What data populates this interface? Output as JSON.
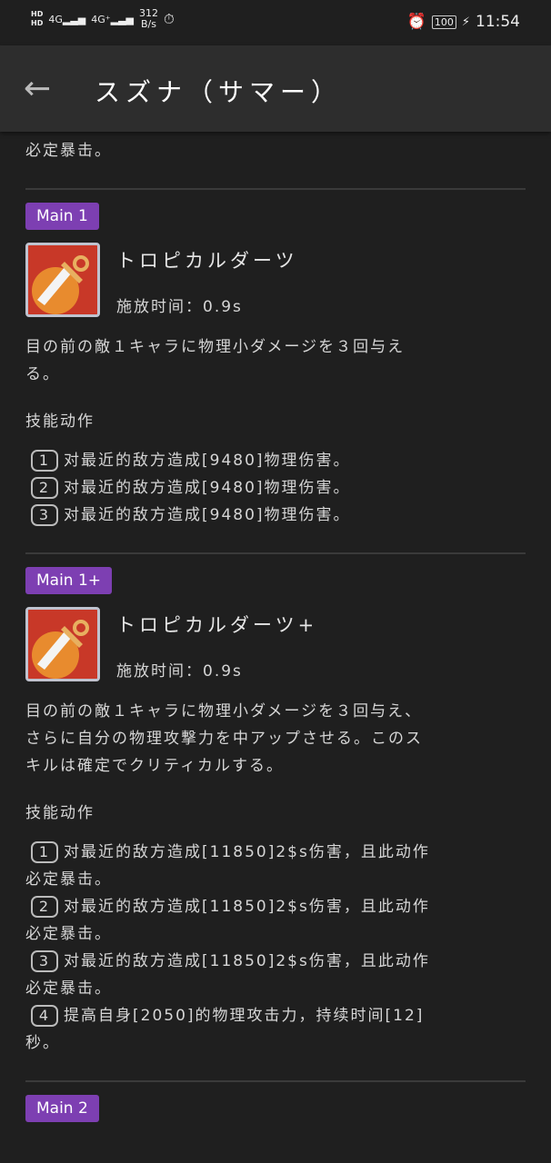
{
  "status": {
    "speed": "312",
    "speed_unit": "B/s",
    "battery": "100",
    "time": "11:54",
    "net1": "4G",
    "net2": "4G⁺"
  },
  "header": {
    "title": "スズナ（サマー）"
  },
  "top_fragment": "必定暴击。",
  "sections": [
    {
      "tag": "Main 1",
      "name": "トロピカルダーツ",
      "cast": "施放时间：0.9s",
      "desc": [
        "目の前の敵１キャラに物理小ダメージを３回与え",
        "る。"
      ],
      "actions_label": "技能动作",
      "actions": [
        {
          "n": "1",
          "text": "对最近的敌方造成[9480]物理伤害。"
        },
        {
          "n": "2",
          "text": "对最近的敌方造成[9480]物理伤害。"
        },
        {
          "n": "3",
          "text": "对最近的敌方造成[9480]物理伤害。"
        }
      ]
    },
    {
      "tag": "Main 1+",
      "name": "トロピカルダーツ+",
      "cast": "施放时间：0.9s",
      "desc": [
        "目の前の敵１キャラに物理小ダメージを３回与え、",
        "さらに自分の物理攻撃力を中アップさせる。このス",
        "キルは確定でクリティカルする。"
      ],
      "actions_label": "技能动作",
      "actions": [
        {
          "n": "1",
          "text": "对最近的敌方造成[11850]2$s伤害，且此动作",
          "cont": "必定暴击。"
        },
        {
          "n": "2",
          "text": "对最近的敌方造成[11850]2$s伤害，且此动作",
          "cont": "必定暴击。"
        },
        {
          "n": "3",
          "text": "对最近的敌方造成[11850]2$s伤害，且此动作",
          "cont": "必定暴击。"
        },
        {
          "n": "4",
          "text": "提高自身[2050]的物理攻击力，持续时间[12]",
          "cont": "秒。"
        }
      ]
    },
    {
      "tag": "Main 2"
    }
  ],
  "colors": {
    "tag": "#7d3fb2",
    "bg": "#1f1f1f",
    "header": "#2d2d2d"
  }
}
